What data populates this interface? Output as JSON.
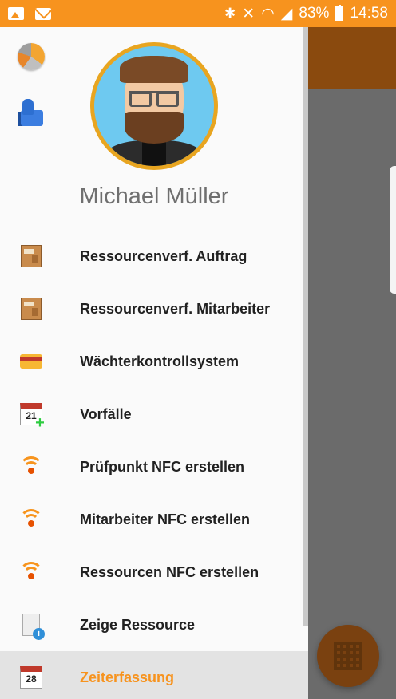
{
  "statusbar": {
    "battery": "83%",
    "time": "14:58"
  },
  "drawer": {
    "username": "Michael Müller",
    "menu": [
      {
        "label": "Ressourcenverf. Auftrag",
        "icon": "package-icon"
      },
      {
        "label": "Ressourcenverf. Mitarbeiter",
        "icon": "package-icon"
      },
      {
        "label": "Wächterkontrollsystem",
        "icon": "card-icon"
      },
      {
        "label": "Vorfälle",
        "icon": "calendar-add-icon"
      },
      {
        "label": "Prüfpunkt NFC erstellen",
        "icon": "nfc-signal-icon"
      },
      {
        "label": "Mitarbeiter NFC erstellen",
        "icon": "nfc-signal-icon"
      },
      {
        "label": "Ressourcen NFC erstellen",
        "icon": "nfc-signal-icon"
      },
      {
        "label": "Zeige Ressource",
        "icon": "document-info-icon"
      },
      {
        "label": "Zeiterfassung",
        "icon": "calendar-icon",
        "active": true
      }
    ],
    "calendar_day_1": "21",
    "calendar_day_2": "28"
  },
  "colors": {
    "statusbar": "#f7931e",
    "appbar": "#8a4a0e",
    "active_label": "#f7931e"
  }
}
